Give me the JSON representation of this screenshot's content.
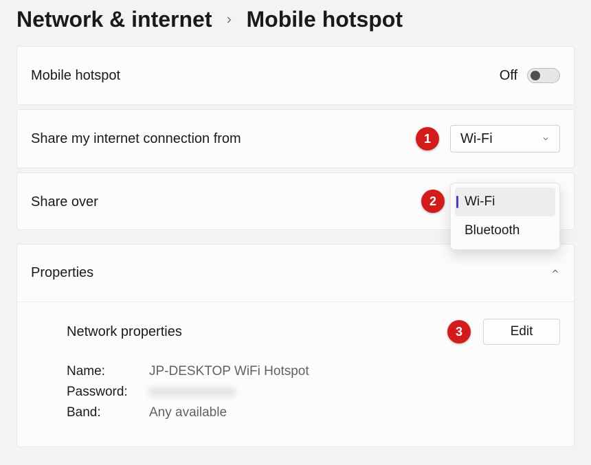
{
  "breadcrumb": {
    "parent": "Network & internet",
    "current": "Mobile hotspot"
  },
  "hotspot": {
    "title": "Mobile hotspot",
    "state_label": "Off"
  },
  "share_from": {
    "label": "Share my internet connection from",
    "selected": "Wi-Fi"
  },
  "share_over": {
    "label": "Share over",
    "options": [
      "Wi-Fi",
      "Bluetooth"
    ],
    "option0": "Wi-Fi",
    "option1": "Bluetooth"
  },
  "properties": {
    "header": "Properties",
    "section_title": "Network properties",
    "edit_label": "Edit",
    "name_key": "Name:",
    "name_val": "JP-DESKTOP WiFi Hotspot",
    "password_key": "Password:",
    "password_val": "xxxxxxxxxxxx",
    "band_key": "Band:",
    "band_val": "Any available"
  },
  "annotations": {
    "step1": "1",
    "step2": "2",
    "step3": "3"
  }
}
